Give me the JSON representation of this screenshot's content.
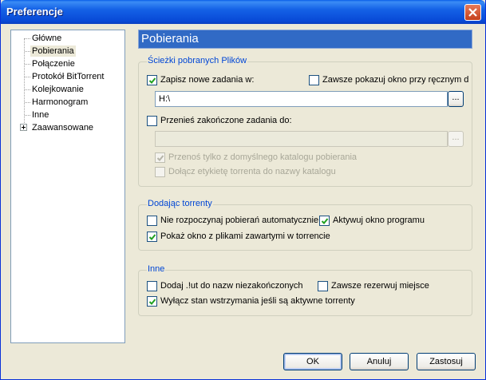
{
  "window": {
    "title": "Preferencje"
  },
  "tree": {
    "items": [
      {
        "label": "Główne"
      },
      {
        "label": "Pobierania"
      },
      {
        "label": "Połączenie"
      },
      {
        "label": "Protokół BitTorrent"
      },
      {
        "label": "Kolejkowanie"
      },
      {
        "label": "Harmonogram"
      },
      {
        "label": "Inne"
      },
      {
        "label": "Zaawansowane"
      }
    ],
    "selected": "Pobierania"
  },
  "page": {
    "title": "Pobierania"
  },
  "paths_group": {
    "title": "Ścieżki pobranych Plików",
    "save_new": {
      "label": "Zapisz nowe zadania w:",
      "checked": true
    },
    "always_show": {
      "label": "Zawsze pokazuj okno przy ręcznym d",
      "checked": false
    },
    "save_path": {
      "value": "H:\\"
    },
    "browse_label": "...",
    "move_completed": {
      "label": "Przenieś zakończone zadania do:",
      "checked": false
    },
    "move_path": {
      "value": ""
    },
    "move_only_default": {
      "label": "Przenoś tylko z domyślnego katalogu pobierania",
      "checked": true,
      "enabled": false
    },
    "append_label": {
      "label": "Dołącz etykietę torrenta do nazwy katalogu",
      "checked": false,
      "enabled": false
    }
  },
  "adding_group": {
    "title": "Dodając torrenty",
    "dont_start": {
      "label": "Nie rozpoczynaj pobierań automatycznie",
      "checked": false
    },
    "activate_window": {
      "label": "Aktywuj okno programu",
      "checked": true
    },
    "show_files": {
      "label": "Pokaż okno z plikami zawartymi w torrencie",
      "checked": true
    }
  },
  "other_group": {
    "title": "Inne",
    "append_ut": {
      "label": "Dodaj .!ut do nazw niezakończonych",
      "checked": false
    },
    "reserve_space": {
      "label": "Zawsze rezerwuj miejsce",
      "checked": false
    },
    "disable_standby": {
      "label": "Wyłącz stan wstrzymania jeśli są aktywne torrenty",
      "checked": true
    }
  },
  "buttons": {
    "ok": "OK",
    "cancel": "Anuluj",
    "apply": "Zastosuj"
  }
}
